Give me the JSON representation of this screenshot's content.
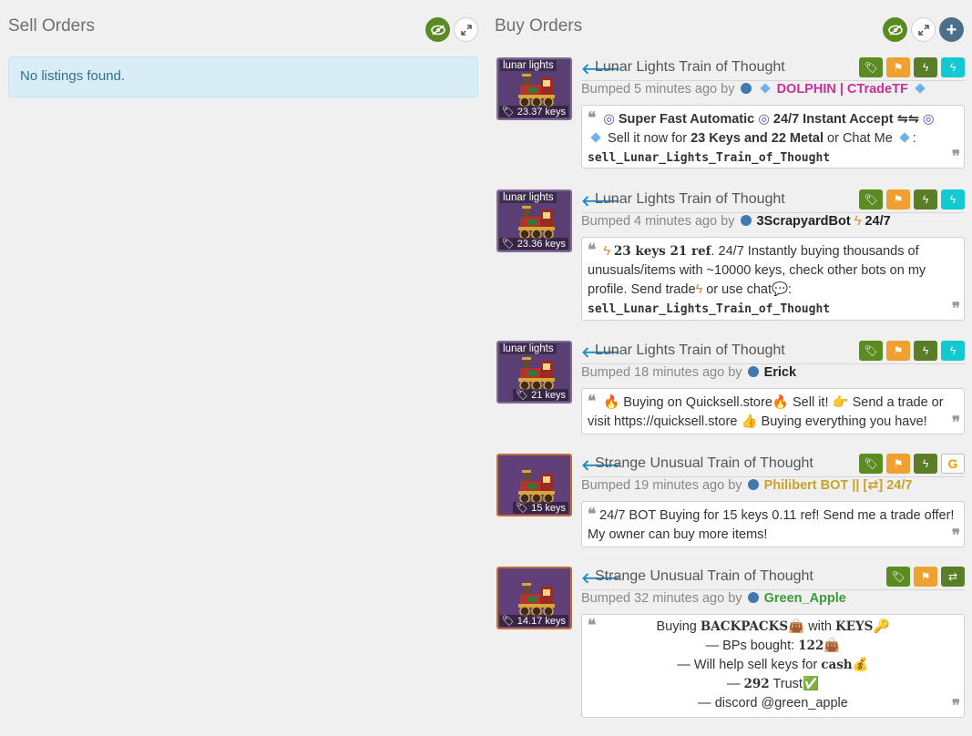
{
  "sell": {
    "title": "Sell Orders",
    "empty_text": "No listings found."
  },
  "buy": {
    "title": "Buy Orders"
  },
  "listings": [
    {
      "item_name": "Lunar Lights Train of Thought",
      "effect_label": "lunar lights",
      "price": "23.37 keys",
      "bumped": "Bumped 5 minutes ago by",
      "user": "DOLPHIN | CTradeTF",
      "user_color": "#c7309a",
      "badges": [
        "tag-icon",
        "flag-icon",
        "lightning-icon",
        "lightning-icon"
      ],
      "desc": {
        "line1_a": "Super Fast Automatic",
        "line1_b": "24/7 Instant Accept ⇋⇋",
        "line2_a": "Sell it now for",
        "line2_b": "23 Keys and 22 Metal",
        "line2_c": "or Chat Me",
        "line2_d": ":",
        "command": "sell_Lunar_Lights_Train_of_Thought"
      }
    },
    {
      "item_name": "Lunar Lights Train of Thought",
      "effect_label": "lunar lights",
      "price": "23.36 keys",
      "bumped": "Bumped 4 minutes ago by",
      "user": "3ScrapyardBot",
      "user_suffix": "24/7",
      "user_color": "#222222",
      "badges": [
        "tag-icon",
        "flag-icon",
        "lightning-icon",
        "lightning-icon"
      ],
      "desc": {
        "bold": "23 keys 21 ref",
        "text1": ". 24/7 Instantly buying thousands of unusuals/items with ~10000 keys, check other bots on my profile. Send",
        "trade": "trade",
        "or_use": "or  use  chat",
        "colon": ":",
        "command": "sell_Lunar_Lights_Train_of_Thought"
      }
    },
    {
      "item_name": "Lunar Lights Train of Thought",
      "effect_label": "lunar lights",
      "price": "21 keys",
      "bumped": "Bumped 18 minutes ago by",
      "user": "Erick",
      "user_color": "#222222",
      "badges": [
        "tag-icon",
        "flag-icon",
        "lightning-icon",
        "lightning-icon"
      ],
      "desc": {
        "text1": "Buying on Quicksell.store",
        "text2": "Sell it!",
        "text3": "Send a trade or visit https://quicksell.store",
        "text4": "Buying everything you have!"
      }
    },
    {
      "item_name": "Strange Unusual Train of Thought",
      "price": "15 keys",
      "bumped": "Bumped 19 minutes ago by",
      "user": "Philibert BOT || [⇄] 24/7",
      "user_color": "#c9a227",
      "badges": [
        "tag-icon",
        "flag-icon",
        "lightning-icon",
        "g-icon"
      ],
      "desc": {
        "text": "24/7 BOT Buying for 15 keys 0.11 ref! Send me a trade offer! My owner can buy more items!"
      }
    },
    {
      "item_name": "Strange Unusual Train of Thought",
      "price": "14.17 keys",
      "bumped": "Bumped 32 minutes ago by",
      "user": "Green_Apple",
      "user_color": "#3a9a3a",
      "badges": [
        "tag-icon",
        "flag-icon",
        "swap-icon"
      ],
      "desc": {
        "l1_a": "Buying",
        "l1_b": "BACKPACKS",
        "l1_c": "with",
        "l1_d": "KEYS",
        "l2_a": "— BPs bought:",
        "l2_b": "122",
        "l3_a": "— Will help sell keys for",
        "l3_b": "cash",
        "l4_a": "—",
        "l4_b": "292",
        "l4_c": "Trust",
        "l5": "— discord @green_apple"
      }
    }
  ]
}
